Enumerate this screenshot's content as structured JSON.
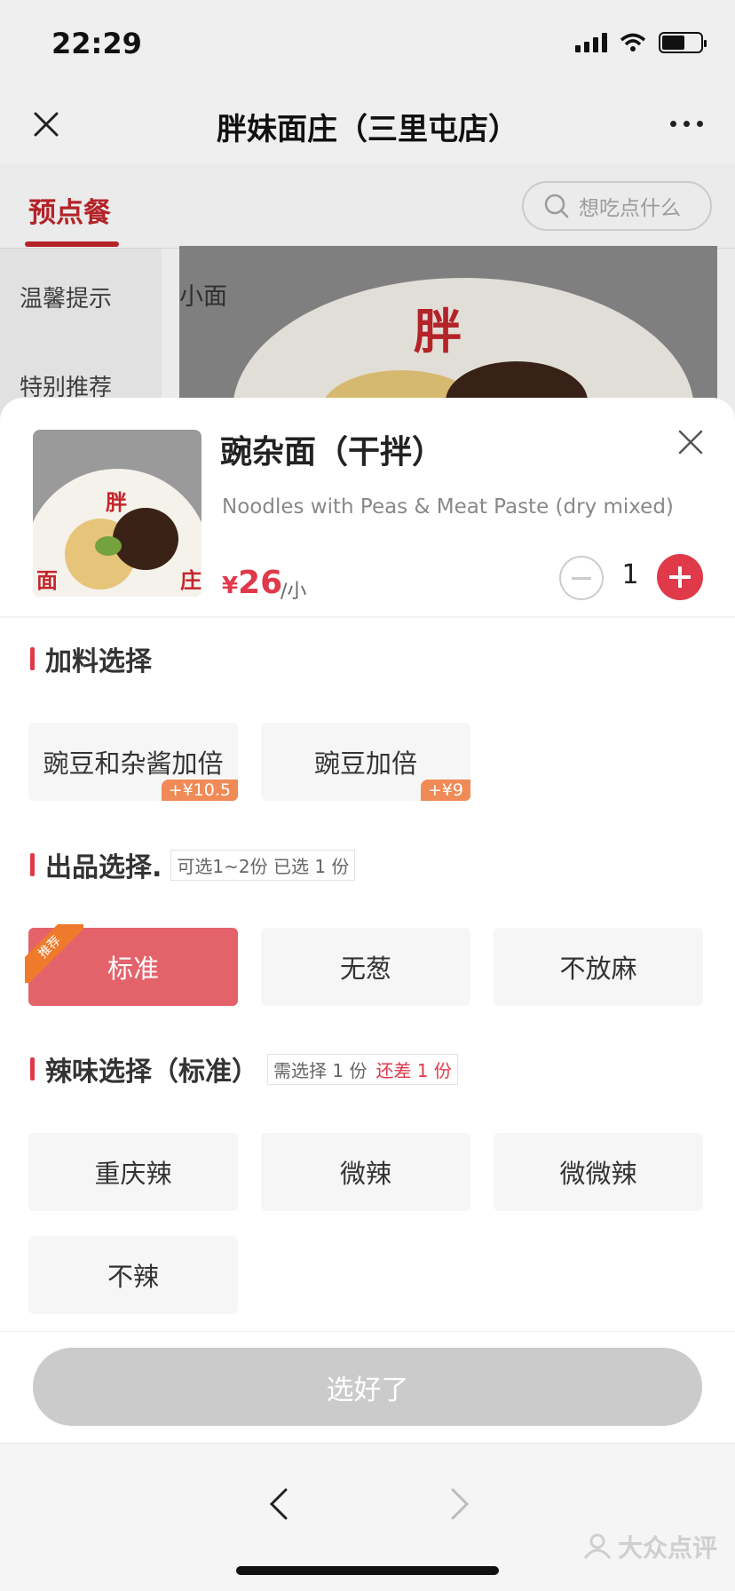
{
  "status_bar": {
    "time": "22:29"
  },
  "nav": {
    "title": "胖妹面庄（三里屯店）"
  },
  "background": {
    "tab_active": "预点餐",
    "search_placeholder": "想吃点什么",
    "sidebar_items": [
      "温馨提示",
      "特别推荐"
    ],
    "category_title": "小面",
    "banner_char": "胖"
  },
  "product": {
    "name": "豌杂面（干拌）",
    "subtitle": "Noodles with Peas & Meat Paste (dry mixed)",
    "price_currency": "¥",
    "price": "26",
    "unit": "/小",
    "quantity": "1",
    "image_chars": [
      "胖",
      "面",
      "庄"
    ]
  },
  "sections": {
    "toppings": {
      "title": "加料选择",
      "options": [
        {
          "label": "豌豆和杂酱加倍",
          "price": "+¥10.5"
        },
        {
          "label": "豌豆加倍",
          "price": "+¥9"
        }
      ]
    },
    "style": {
      "title": "出品选择.",
      "hint": "可选1~2份 已选 1 份",
      "badge": "推荐",
      "options": [
        {
          "label": "标准",
          "selected": true
        },
        {
          "label": "无葱",
          "selected": false
        },
        {
          "label": "不放麻",
          "selected": false
        }
      ]
    },
    "spice": {
      "title": "辣味选择（标准）",
      "hint": "需选择 1 份",
      "hint_warn": "还差 1 份",
      "options": [
        {
          "label": "重庆辣"
        },
        {
          "label": "微辣"
        },
        {
          "label": "微微辣"
        },
        {
          "label": "不辣"
        }
      ]
    }
  },
  "confirm_label": "选好了",
  "watermark": "大众点评",
  "colors": {
    "accent": "#e0394a",
    "selected": "#e4636b",
    "brand_red": "#c3262c",
    "price_tag": "#f08a56"
  }
}
